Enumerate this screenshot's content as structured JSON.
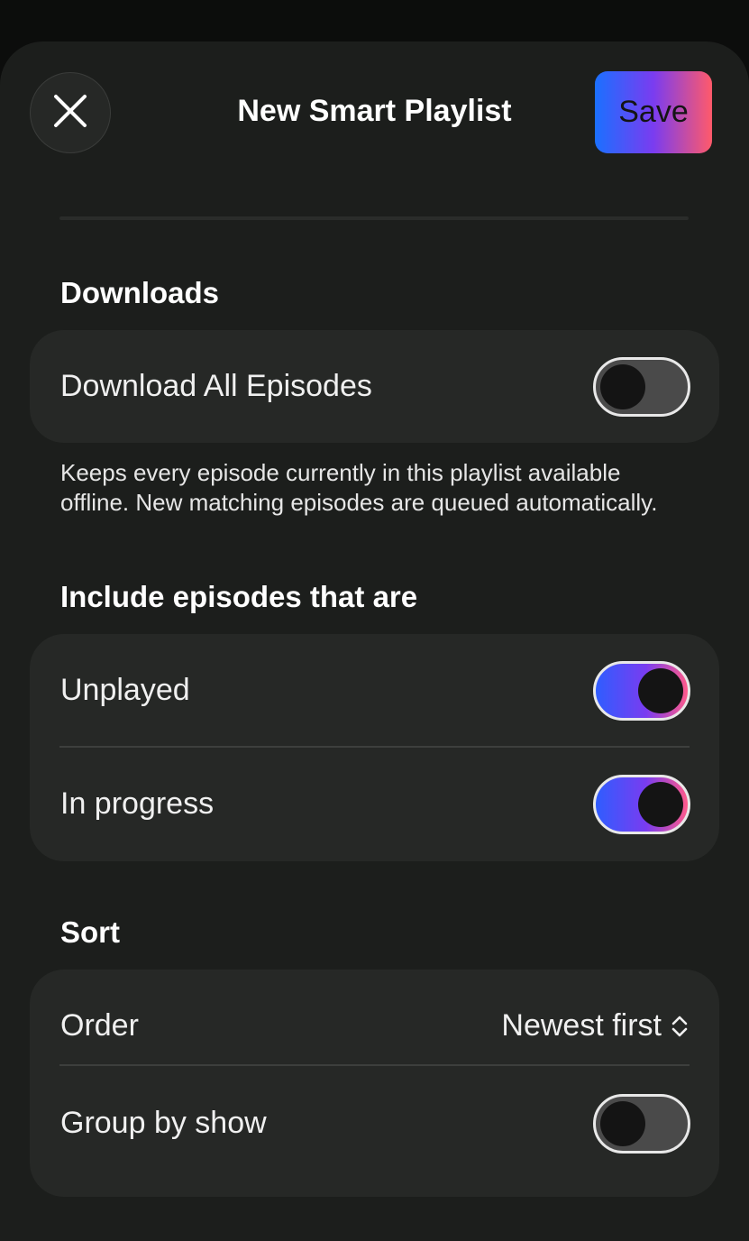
{
  "header": {
    "title": "New Smart Playlist",
    "save_label": "Save",
    "close_icon": "close-icon"
  },
  "downloads": {
    "section_title": "Downloads",
    "download_all_label": "Download All Episodes",
    "download_all_on": false,
    "description": "Keeps every episode currently in this playlist available offline. New matching episodes are queued automatically."
  },
  "include": {
    "section_title": "Include episodes that are",
    "items": [
      {
        "label": "Unplayed",
        "on": true
      },
      {
        "label": "In progress",
        "on": true
      }
    ]
  },
  "sort": {
    "section_title": "Sort",
    "order_label": "Order",
    "order_value": "Newest first",
    "order_icon": "chevron-up-down-icon",
    "group_label": "Group by show",
    "group_on": false
  },
  "colors": {
    "accent_gradient_start": "#1b70ff",
    "accent_gradient_mid": "#7a3cf0",
    "accent_gradient_end": "#ff5a6a",
    "background": "#1c1e1c",
    "card": "#262826"
  }
}
